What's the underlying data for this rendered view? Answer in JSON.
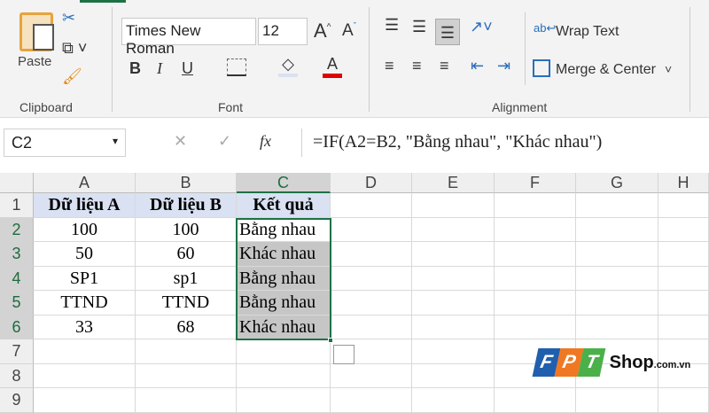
{
  "ribbon": {
    "clipboard": {
      "paste": "Paste",
      "group": "Clipboard"
    },
    "font": {
      "name": "Times New Roman",
      "size": "12",
      "bold": "B",
      "italic": "I",
      "underline": "U",
      "group": "Font",
      "font_color": "#e00000"
    },
    "alignment": {
      "wrap_text": "Wrap Text",
      "merge_center": "Merge & Center",
      "group": "Alignment"
    }
  },
  "formula_bar": {
    "name_box": "C2",
    "fx": "fx",
    "formula": "=IF(A2=B2, \"Bằng nhau\", \"Khác nhau\")"
  },
  "columns": [
    "A",
    "B",
    "C",
    "D",
    "E",
    "F",
    "G",
    "H"
  ],
  "rows": [
    "1",
    "2",
    "3",
    "4",
    "5",
    "6",
    "7",
    "8",
    "9"
  ],
  "cells": [
    [
      "Dữ liệu A",
      "Dữ liệu B",
      "Kết quả"
    ],
    [
      "100",
      "100",
      "Bằng nhau"
    ],
    [
      "50",
      "60",
      "Khác nhau"
    ],
    [
      "SP1",
      "sp1",
      "Bằng nhau"
    ],
    [
      "TTND",
      "TTND",
      "Bằng nhau"
    ],
    [
      "33",
      "68",
      "Khác nhau"
    ]
  ],
  "watermark": {
    "logo": "FPT",
    "text": "Shop",
    "suffix": ".com.vn"
  }
}
